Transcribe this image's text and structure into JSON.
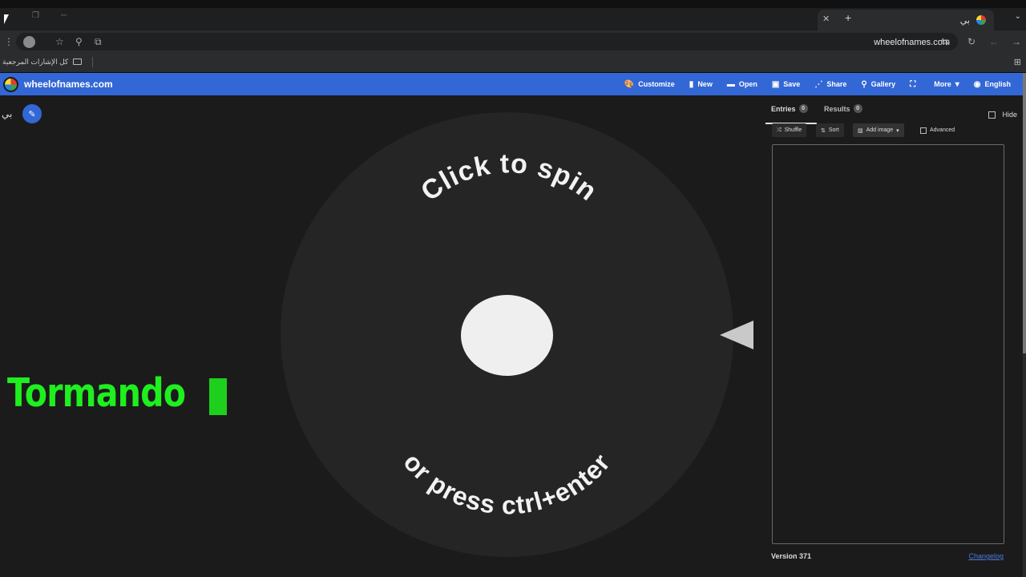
{
  "browser": {
    "tab_title": "بي",
    "url": "wheelofnames.com",
    "bookmarks_label": "كل الإشارات المرجعية"
  },
  "site": {
    "name": "wheelofnames.com",
    "menu": [
      {
        "label": "Customize",
        "icon": "palette-icon",
        "glyph": "🎨"
      },
      {
        "label": "New",
        "icon": "file-icon",
        "glyph": "▮"
      },
      {
        "label": "Open",
        "icon": "folder-icon",
        "glyph": "▬"
      },
      {
        "label": "Save",
        "icon": "save-icon",
        "glyph": "▣"
      },
      {
        "label": "Share",
        "icon": "share-icon",
        "glyph": "⋰"
      },
      {
        "label": "Gallery",
        "icon": "search-icon",
        "glyph": "⚲"
      },
      {
        "label": "",
        "icon": "fullscreen-icon",
        "glyph": "⛶"
      },
      {
        "label": "More",
        "icon": "chevron-down-icon",
        "glyph": "▾"
      },
      {
        "label": "English",
        "icon": "globe-icon",
        "glyph": "◉"
      }
    ]
  },
  "wheel": {
    "title": "بي",
    "top_text": "Click to spin",
    "bottom_text": "or press ctrl+enter"
  },
  "overlay": {
    "text": "Tormando"
  },
  "panel": {
    "tab_entries": "Entries",
    "entries_count": "0",
    "tab_results": "Results",
    "results_count": "0",
    "hide_label": "Hide",
    "shuffle_label": "Shuffle",
    "sort_label": "Sort",
    "add_image_label": "Add image",
    "advanced_label": "Advanced",
    "entries_text": "",
    "version": "Version 371",
    "changelog": "Changelog"
  },
  "colors": {
    "header_blue": "#3367d6",
    "overlay_green": "#1fef1f",
    "link_blue": "#4d7be0"
  }
}
